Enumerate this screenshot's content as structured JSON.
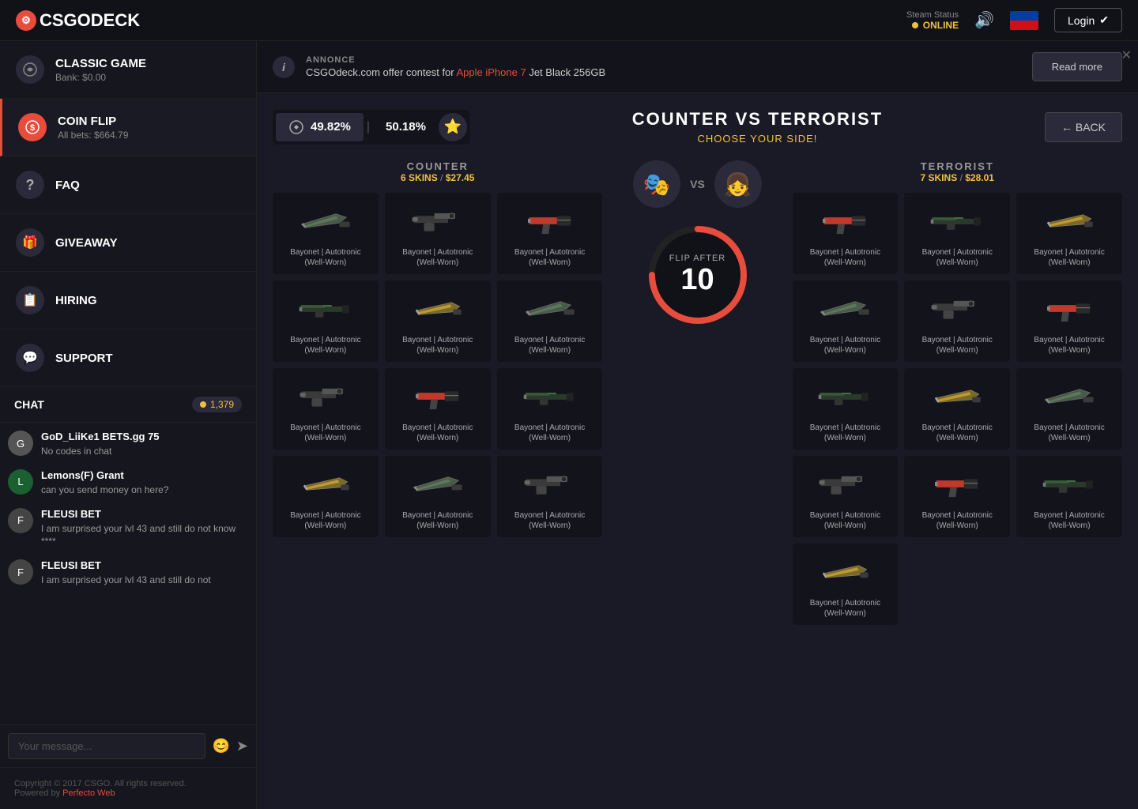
{
  "header": {
    "logo": "CSGODECK",
    "steam_status_label": "Steam Status",
    "online_label": "ONLINE",
    "login_label": "Login"
  },
  "sidebar": {
    "classic_game": {
      "title": "CLASSIC GAME",
      "subtitle": "Bank: $0.00"
    },
    "coin_flip": {
      "title": "COIN FLIP",
      "subtitle": "All bets: $664.79"
    },
    "nav_items": [
      {
        "label": "FAQ",
        "icon": "?"
      },
      {
        "label": "GIVEAWAY",
        "icon": "🎁"
      },
      {
        "label": "HIRING",
        "icon": "📋"
      },
      {
        "label": "SUPPORT",
        "icon": "💬"
      }
    ],
    "chat": {
      "title": "CHAT",
      "count": "1,379",
      "messages": [
        {
          "user": "GoD_LiiKe1 BETS.gg 75",
          "text": "No codes in chat"
        },
        {
          "user": "Lemons(F) Grant",
          "text": "can you send money on here?"
        },
        {
          "user": "FLEUSI BET",
          "text": "I am surprised your lvl 43 and still do not know ****"
        },
        {
          "user": "FLEUSI BET",
          "text": "I am surprised your lvl 43 and still do not"
        }
      ],
      "input_placeholder": "Your message..."
    },
    "footer": {
      "copyright": "Copyright © 2017 CSGO. All rights reserved.",
      "powered_by": "Powered by ",
      "powered_link": "Perfecto Web"
    }
  },
  "announcement": {
    "label": "ANNONCE",
    "text_before": "CSGOdeck.com offer contest for ",
    "highlight": "Apple iPhone 7",
    "text_after": " Jet Black 256GB",
    "read_more": "Read more"
  },
  "game": {
    "title": "COUNTER VS TERRORIST",
    "subtitle": "CHOOSE YOUR SIDE!",
    "back_label": "← BACK",
    "counter_pct": "49.82%",
    "terrorist_pct": "50.18%",
    "counter": {
      "label": "COUNTER",
      "skins_count": "6 SKINS",
      "value": "$27.45",
      "skins": [
        {
          "name": "Bayonet | Autotronic\n(Well-Worn)"
        },
        {
          "name": "Bayonet | Autotronic\n(Well-Worn)"
        },
        {
          "name": "Bayonet | Autotronic\n(Well-Worn)"
        },
        {
          "name": "Bayonet | Autotronic\n(Well-Worn)"
        },
        {
          "name": "Bayonet | Autotronic\n(Well-Worn)"
        },
        {
          "name": "Bayonet | Autotronic\n(Well-Worn)"
        },
        {
          "name": "Bayonet | Autotronic\n(Well-Worn)"
        },
        {
          "name": "Bayonet | Autotronic\n(Well-Worn)"
        },
        {
          "name": "Bayonet | Autotronic\n(Well-Worn)"
        },
        {
          "name": "Bayonet | Autotronic\n(Well-Worn)"
        },
        {
          "name": "Bayonet | Autotronic\n(Well-Worn)"
        },
        {
          "name": "Bayonet | Autotronic\n(Well-Worn)"
        }
      ]
    },
    "terrorist": {
      "label": "TERRORIST",
      "skins_count": "7 SKINS",
      "value": "$28.01",
      "skins": [
        {
          "name": "Bayonet | Autotronic\n(Well-Worn)"
        },
        {
          "name": "Bayonet | Autotronic\n(Well-Worn)"
        },
        {
          "name": "Bayonet | Autotronic\n(Well-Worn)"
        },
        {
          "name": "Bayonet | Autotronic\n(Well-Worn)"
        },
        {
          "name": "Bayonet | Autotronic\n(Well-Worn)"
        },
        {
          "name": "Bayonet | Autotronic\n(Well-Worn)"
        },
        {
          "name": "Bayonet | Autotronic\n(Well-Worn)"
        },
        {
          "name": "Bayonet | Autotronic\n(Well-Worn)"
        },
        {
          "name": "Bayonet | Autotronic\n(Well-Worn)"
        },
        {
          "name": "Bayonet | Autotronic\n(Well-Worn)"
        },
        {
          "name": "Bayonet | Autotronic\n(Well-Worn)"
        },
        {
          "name": "Bayonet | Autotronic\n(Well-Worn)"
        },
        {
          "name": "Bayonet | Autotronic\n(Well-Worn)"
        }
      ]
    },
    "flip_after_label": "FLIP AFTER",
    "flip_number": "10",
    "vs_label": "VS"
  }
}
